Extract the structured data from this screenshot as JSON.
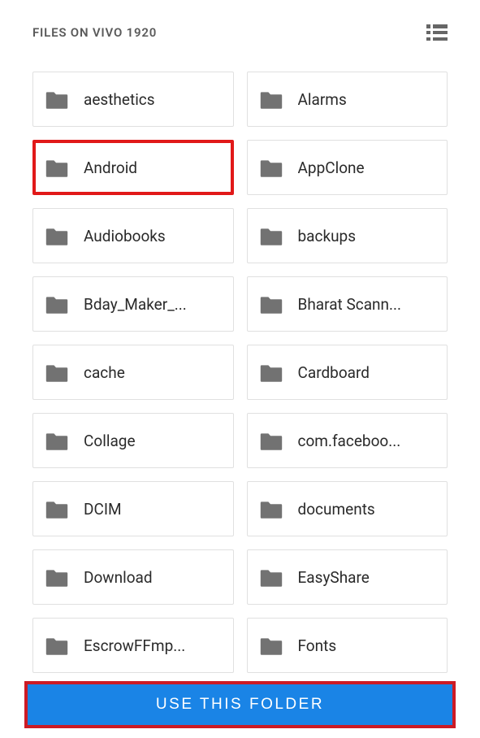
{
  "header": {
    "title": "FILES ON VIVO 1920"
  },
  "folders": [
    {
      "label": "aesthetics",
      "highlighted": false
    },
    {
      "label": "Alarms",
      "highlighted": false
    },
    {
      "label": "Android",
      "highlighted": true
    },
    {
      "label": "AppClone",
      "highlighted": false
    },
    {
      "label": "Audiobooks",
      "highlighted": false
    },
    {
      "label": "backups",
      "highlighted": false
    },
    {
      "label": "Bday_Maker_...",
      "highlighted": false
    },
    {
      "label": "Bharat Scann...",
      "highlighted": false
    },
    {
      "label": "cache",
      "highlighted": false
    },
    {
      "label": "Cardboard",
      "highlighted": false
    },
    {
      "label": "Collage",
      "highlighted": false
    },
    {
      "label": "com.faceboo...",
      "highlighted": false
    },
    {
      "label": "DCIM",
      "highlighted": false
    },
    {
      "label": "documents",
      "highlighted": false
    },
    {
      "label": "Download",
      "highlighted": false
    },
    {
      "label": "EasyShare",
      "highlighted": false
    },
    {
      "label": "EscrowFFmp...",
      "highlighted": false
    },
    {
      "label": "Fonts",
      "highlighted": false
    }
  ],
  "action": {
    "button_label": "USE THIS FOLDER"
  }
}
